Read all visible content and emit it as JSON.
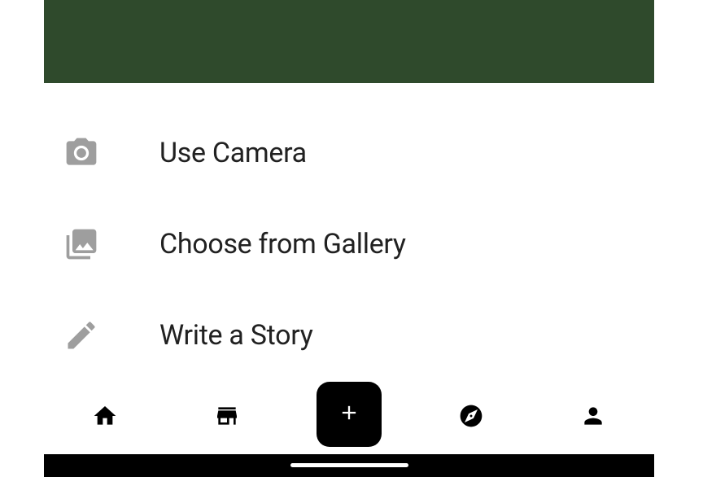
{
  "options": {
    "camera": {
      "label": "Use Camera",
      "icon": "camera-icon"
    },
    "gallery": {
      "label": "Choose from Gallery",
      "icon": "gallery-icon"
    },
    "story": {
      "label": "Write a Story",
      "icon": "pencil-icon"
    }
  },
  "nav": {
    "home": "home-icon",
    "store": "store-icon",
    "add": "plus-icon",
    "explore": "compass-icon",
    "profile": "person-icon"
  }
}
